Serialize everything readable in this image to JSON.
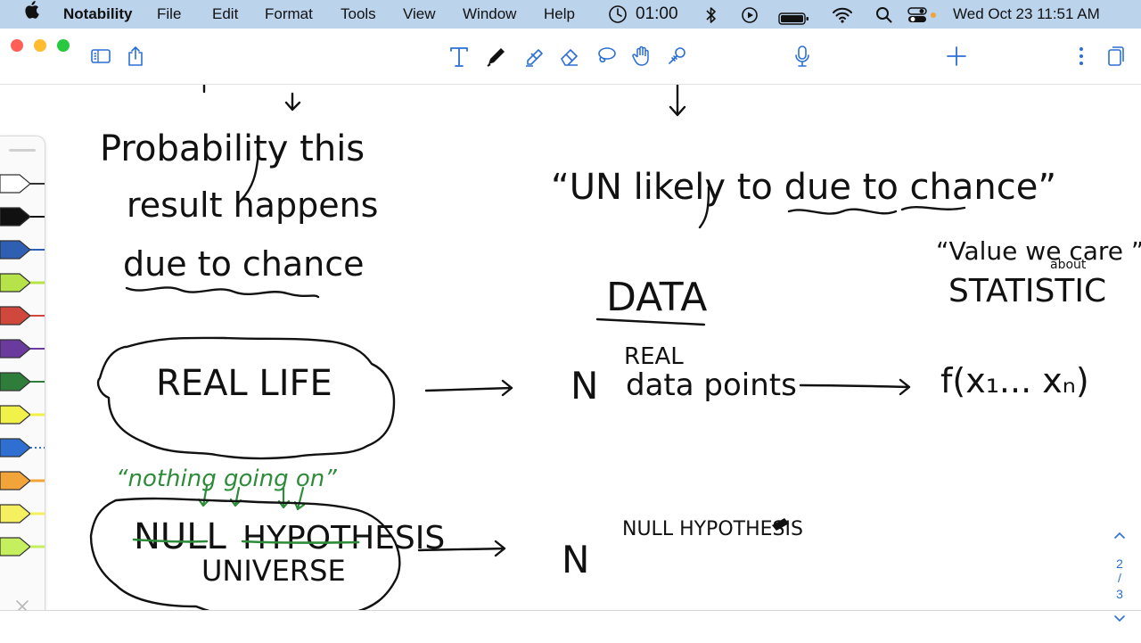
{
  "menubar": {
    "app_name": "Notability",
    "menus": [
      "File",
      "Edit",
      "Format",
      "Tools",
      "View",
      "Window",
      "Help"
    ],
    "timer": "01:00",
    "datetime": "Wed Oct 23  11:51 AM"
  },
  "pager": {
    "current": "2",
    "separator": "/",
    "total": "3"
  },
  "notes": {
    "probability_line1": "Probability this",
    "probability_line2": "result happens",
    "due_to_chance": "due to chance",
    "unlikely": "“UN likely to due to chance”",
    "value_we_care": "“Value we care ”",
    "about": "about",
    "statistic": "STATISTIC",
    "data": "DATA",
    "real_small": "REAL",
    "n1": "N",
    "data_points": "data points",
    "fx": "f(x₁... xₙ)",
    "real_life": "REAL LIFE",
    "nothing_going_on": "“nothing going on”",
    "null_hyp_word1": "NULL",
    "null_hyp_word2": "HYPOTHESIS",
    "universe": "UNIVERSE",
    "n2": "N",
    "null_hyp_small": "NULL HYPOTHESIS"
  },
  "colors": {
    "menubar_bg": "#bcd3ec",
    "ink": "#111111",
    "green_ink": "#2e8b3a",
    "accent": "#2b6fd6",
    "close": "#ff5f57",
    "minimize": "#febc2e",
    "zoom": "#28c840"
  },
  "palette_pens": [
    {
      "name": "outline-pen",
      "color": "#ffffff"
    },
    {
      "name": "black-pen",
      "color": "#111111"
    },
    {
      "name": "blue-pen",
      "color": "#2f5fb3"
    },
    {
      "name": "lime-highlighter",
      "color": "#b6e34a"
    },
    {
      "name": "red-pen",
      "color": "#d0483c"
    },
    {
      "name": "purple-pen",
      "color": "#6a3a9c"
    },
    {
      "name": "green-pen",
      "color": "#2e7d3a"
    },
    {
      "name": "yellow-highlighter",
      "color": "#f1f14a"
    },
    {
      "name": "blue-dotted-pen",
      "color": "#2f6fd1"
    },
    {
      "name": "orange-highlighter",
      "color": "#f0a43a"
    },
    {
      "name": "yellow-highlighter-2",
      "color": "#f5f060"
    },
    {
      "name": "lime-highlighter-2",
      "color": "#c6ef60"
    }
  ]
}
